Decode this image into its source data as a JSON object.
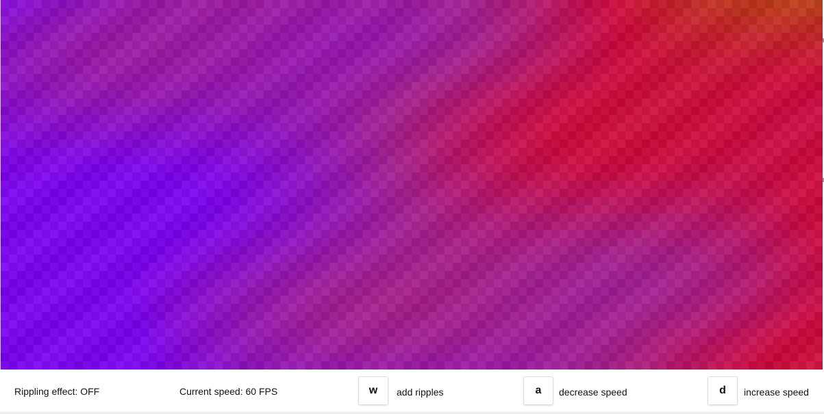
{
  "colors": {
    "purple": "#7c0ae8",
    "magenta": "#a0258e",
    "crimson": "#c81040",
    "rust": "#b8401c"
  },
  "status": {
    "rippling": "Rippling effect: OFF",
    "speed": "Current speed: 60 FPS"
  },
  "controls": [
    {
      "key": "w",
      "label": "add ripples"
    },
    {
      "key": "a",
      "label": "decrease speed"
    },
    {
      "key": "d",
      "label": "increase speed"
    }
  ]
}
